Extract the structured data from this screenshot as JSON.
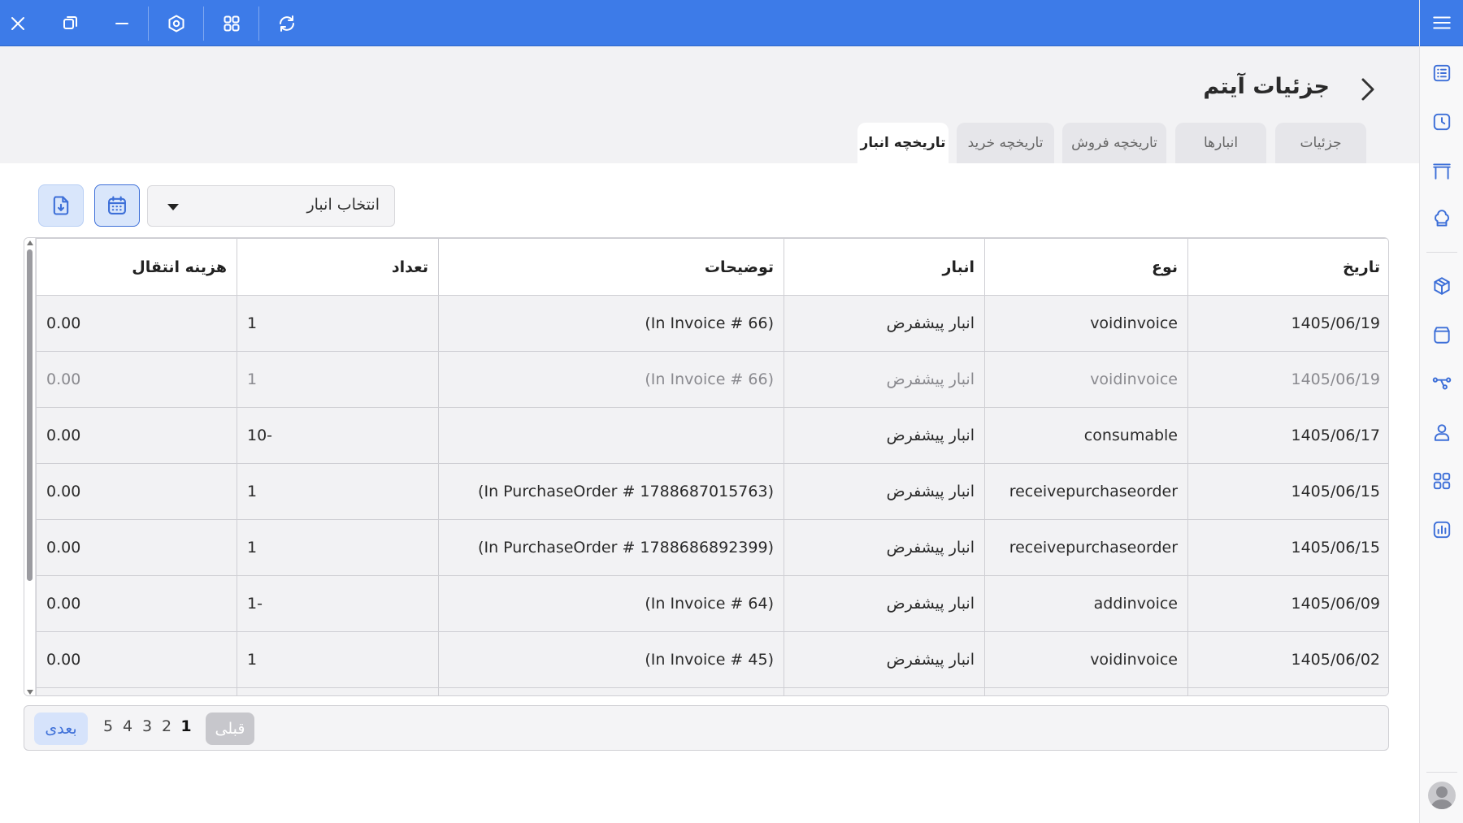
{
  "page": {
    "title": "جزئیات آیتم"
  },
  "tabs": [
    {
      "label": "جزئیات"
    },
    {
      "label": "انبارها"
    },
    {
      "label": "تاریخچه فروش"
    },
    {
      "label": "تاریخچه خرید"
    },
    {
      "label": "تاریخچه انبار",
      "active": true
    }
  ],
  "toolbar": {
    "warehouse_select": "انتخاب انبار"
  },
  "table": {
    "headers": {
      "date": "تاریخ",
      "type": "نوع",
      "warehouse": "انبار",
      "description": "توضیحات",
      "quantity": "تعداد",
      "transfer_cost": "هزینه انتقال"
    },
    "rows": [
      {
        "date": "1405/06/19",
        "type": "voidinvoice",
        "warehouse": "انبار پیشفرض",
        "description": "(In Invoice # 66)",
        "quantity": "1",
        "transfer_cost": "0.00"
      },
      {
        "date": "1405/06/19",
        "type": "voidinvoice",
        "warehouse": "انبار پیشفرض",
        "description": "(In Invoice # 66)",
        "quantity": "1",
        "transfer_cost": "0.00"
      },
      {
        "date": "1405/06/17",
        "type": "consumable",
        "warehouse": "انبار پیشفرض",
        "description": "",
        "quantity": "10-",
        "transfer_cost": "0.00"
      },
      {
        "date": "1405/06/15",
        "type": "receivepurchaseorder",
        "warehouse": "انبار پیشفرض",
        "description": "(In PurchaseOrder # 1788687015763)",
        "quantity": "1",
        "transfer_cost": "0.00"
      },
      {
        "date": "1405/06/15",
        "type": "receivepurchaseorder",
        "warehouse": "انبار پیشفرض",
        "description": "(In PurchaseOrder # 1788686892399)",
        "quantity": "1",
        "transfer_cost": "0.00"
      },
      {
        "date": "1405/06/09",
        "type": "addinvoice",
        "warehouse": "انبار پیشفرض",
        "description": "(In Invoice # 64)",
        "quantity": "1-",
        "transfer_cost": "0.00"
      },
      {
        "date": "1405/06/02",
        "type": "voidinvoice",
        "warehouse": "انبار پیشفرض",
        "description": "(In Invoice # 45)",
        "quantity": "1",
        "transfer_cost": "0.00"
      }
    ]
  },
  "pagination": {
    "prev_label": "قبلی",
    "next_label": "بعدی",
    "pages": [
      "1",
      "2",
      "3",
      "4",
      "5"
    ],
    "current": "1"
  },
  "colors": {
    "accent": "#3d7be8",
    "header_bg": "#f2f2f4"
  }
}
